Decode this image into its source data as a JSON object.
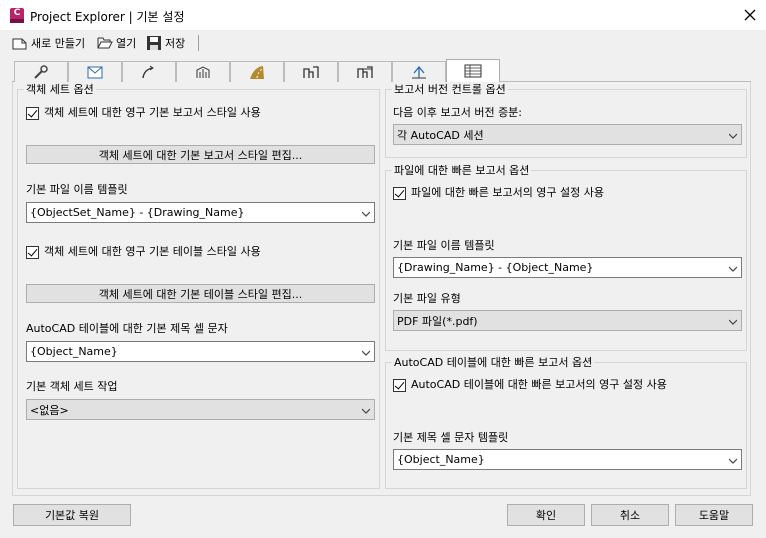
{
  "window": {
    "title": "Project Explorer | 기본 설정",
    "app_icon_letter": "C"
  },
  "toolbar": {
    "new_label": "새로 만들기",
    "open_label": "열기",
    "save_label": "저장"
  },
  "tabs": [
    {
      "icon": "wrench-icon"
    },
    {
      "icon": "envelope-icon"
    },
    {
      "icon": "alignment-icon"
    },
    {
      "icon": "network-icon"
    },
    {
      "icon": "road-icon"
    },
    {
      "icon": "profile-icon"
    },
    {
      "icon": "section-icon"
    },
    {
      "icon": "survey-icon"
    },
    {
      "icon": "report-table-icon",
      "active": true
    }
  ],
  "left": {
    "objset_group_title": "객체 세트 옵션",
    "persist_report_style_label": "객체 세트에 대한 영구 기본 보고서 스타일 사용",
    "edit_report_style_button": "객체 세트에 대한 기본 보고서 스타일 편집...",
    "file_template_label": "기본 파일 이름 템플릿",
    "file_template_value": "{ObjectSet_Name} - {Drawing_Name}",
    "persist_table_style_label": "객체 세트에 대한 영구 기본 테이블 스타일 사용",
    "edit_table_style_button": "객체 세트에 대한 기본 테이블 스타일 편집...",
    "table_title_label": "AutoCAD 테이블에 대한 기본 제목 셀 문자",
    "table_title_value": "{Object_Name}",
    "default_task_label": "기본 객체 세트 작업",
    "default_task_value": "<없음>"
  },
  "right": {
    "version_group_title": "보고서 버전 컨트롤 옵션",
    "version_increment_label": "다음 이후 보고서 버전 증분:",
    "version_increment_value": "각 AutoCAD 세션",
    "file_quick_group_title": "파일에 대한 빠른 보고서 옵션",
    "file_quick_persist_label": "파일에 대한 빠른 보고서의 영구 설정 사용",
    "file_quick_template_label": "기본 파일 이름 템플릿",
    "file_quick_template_value": "{Drawing_Name} - {Object_Name}",
    "file_type_label": "기본 파일 유형",
    "file_type_value": "PDF 파일(*.pdf)",
    "table_quick_group_title": "AutoCAD 테이블에 대한 빠른 보고서 옵션",
    "table_quick_persist_label": "AutoCAD 테이블에 대한 빠른 보고서의 영구 설정 사용",
    "table_quick_title_label": "기본 제목 셀 문자 템플릿",
    "table_quick_title_value": "{Object_Name}"
  },
  "footer": {
    "restore_defaults": "기본값 복원",
    "ok": "확인",
    "cancel": "취소",
    "help": "도움말"
  },
  "colors": {
    "app_icon": "#b8246a",
    "background": "#f0f0f0"
  }
}
